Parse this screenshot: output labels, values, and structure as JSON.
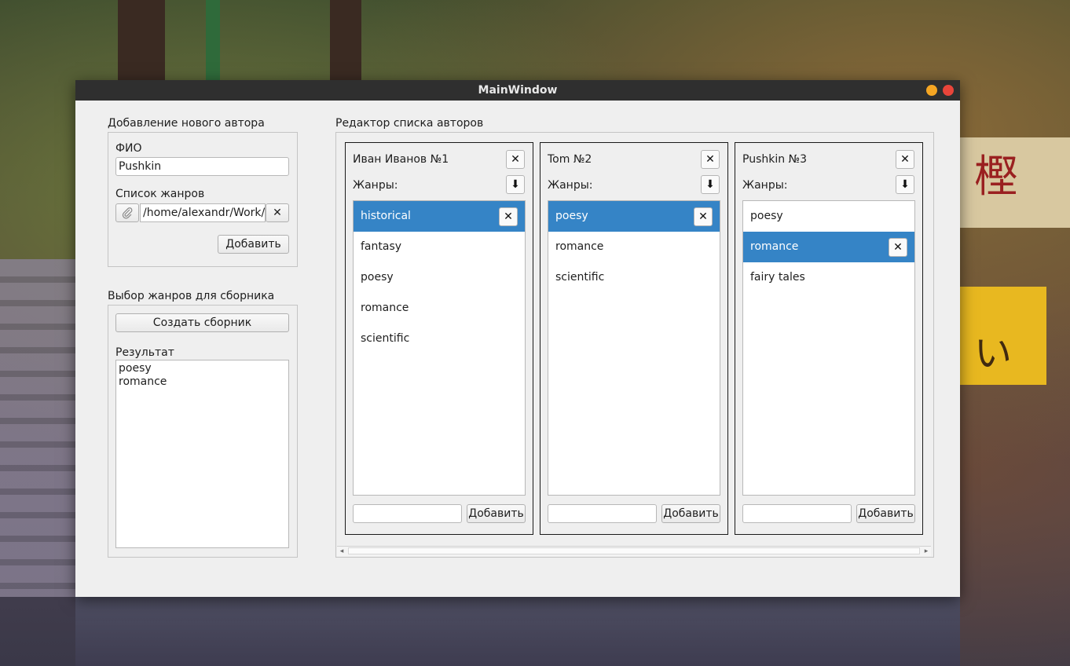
{
  "window": {
    "title": "MainWindow"
  },
  "add_author": {
    "section_title": "Добавление нового автора",
    "name_label": "ФИО",
    "name_value": "Pushkin",
    "genres_label": "Список жанров",
    "genres_path_value": "/home/alexandr/Work/",
    "add_button": "Добавить"
  },
  "collection": {
    "section_title": "Выбор жанров для сборника",
    "create_button": "Создать сборник",
    "result_label": "Результат",
    "results": [
      "poesy",
      "romance"
    ]
  },
  "editor": {
    "section_title": "Редактор списка авторов",
    "authors": [
      {
        "title": "Иван Иванов  №1",
        "genres_label": "Жанры:",
        "add_button": "Добавить",
        "new_genre_value": "",
        "genres": [
          "historical",
          "fantasy",
          "poesy",
          "romance",
          "scientific"
        ],
        "selected_index": 0
      },
      {
        "title": "Tom  №2",
        "genres_label": "Жанры:",
        "add_button": "Добавить",
        "new_genre_value": "",
        "genres": [
          "poesy",
          "romance",
          "scientific"
        ],
        "selected_index": 0
      },
      {
        "title": "Pushkin  №3",
        "genres_label": "Жанры:",
        "add_button": "Добавить",
        "new_genre_value": "",
        "genres": [
          "poesy",
          "romance",
          "fairy tales"
        ],
        "selected_index": 1
      }
    ]
  },
  "icons": {
    "close": "✕",
    "attach": "paperclip-icon",
    "download": "⬇",
    "scroll_left": "◂",
    "scroll_right": "▸"
  },
  "colors": {
    "selection": "#3584c6",
    "titlebar": "#2f2f2f",
    "minimize": "#f5a623",
    "close": "#e9453a"
  }
}
